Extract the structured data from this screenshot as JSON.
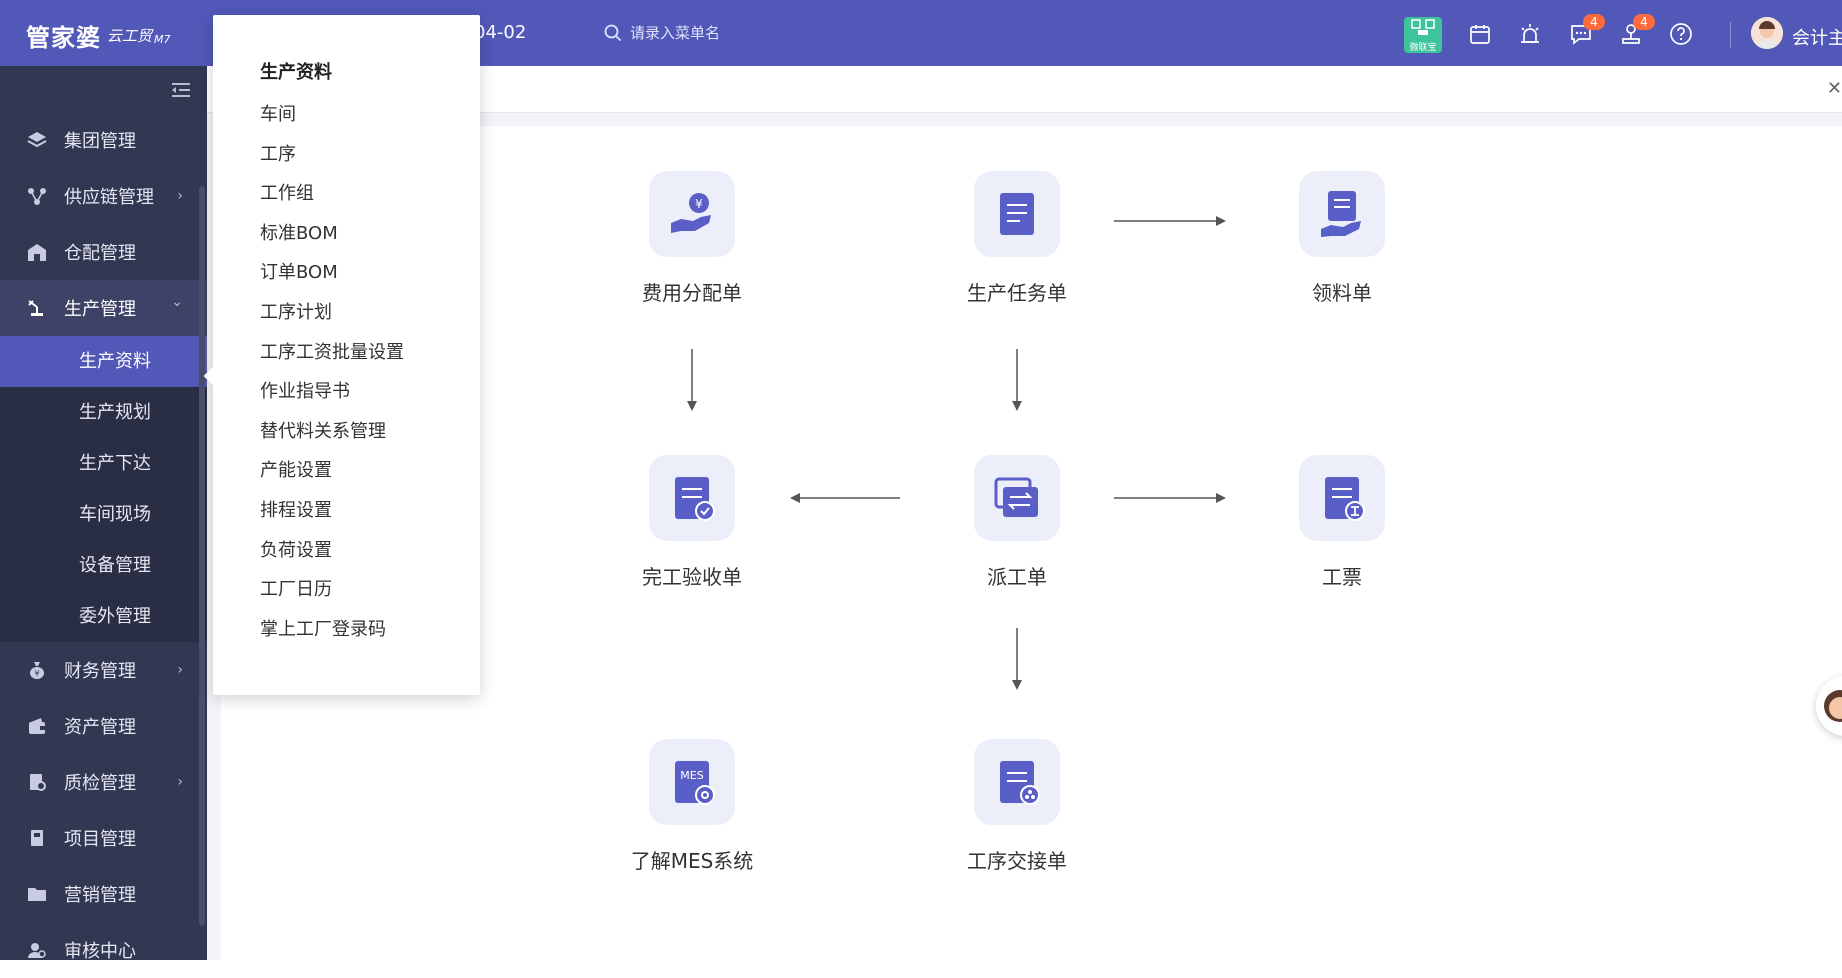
{
  "header": {
    "logo_text": "管家婆",
    "logo_sub": "云工贸",
    "logo_version": "M7",
    "date_text": "04-02",
    "search_placeholder": "请录入菜单名",
    "qr_label": "微联宝",
    "messages_badge": "4",
    "approvals_badge": "4",
    "user_name": "会计主",
    "accent_color": "#5258b8",
    "badge_color": "#ff6a3d"
  },
  "sidebar": {
    "items": [
      {
        "label": "集团管理",
        "icon": "layers-icon"
      },
      {
        "label": "供应链管理",
        "icon": "network-icon",
        "chevron": "›"
      },
      {
        "label": "仓配管理",
        "icon": "warehouse-icon"
      },
      {
        "label": "生产管理",
        "icon": "factory-icon",
        "chevron": "⌄"
      },
      {
        "label": "财务管理",
        "icon": "money-bag-icon",
        "chevron": "›"
      },
      {
        "label": "资产管理",
        "icon": "wallet-icon"
      },
      {
        "label": "质检管理",
        "icon": "inspection-icon",
        "chevron": "›"
      },
      {
        "label": "项目管理",
        "icon": "project-icon"
      },
      {
        "label": "营销管理",
        "icon": "folder-icon"
      },
      {
        "label": "审核中心",
        "icon": "audit-icon"
      }
    ],
    "production_sub": [
      {
        "label": "生产资料"
      },
      {
        "label": "生产规划"
      },
      {
        "label": "生产下达"
      },
      {
        "label": "车间现场"
      },
      {
        "label": "设备管理"
      },
      {
        "label": "委外管理"
      }
    ]
  },
  "flow": {
    "nodes": {
      "cost_allocation": "费用分配单",
      "production_task": "生产任务单",
      "material_requisition": "领料单",
      "completion_acceptance": "完工验收单",
      "dispatch": "派工单",
      "work_ticket": "工票",
      "mes_intro": "了解MES系统",
      "process_handover": "工序交接单"
    },
    "mes_icon_text": "MES"
  },
  "popover": {
    "title": "生产资料",
    "items": [
      "车间",
      "工序",
      "工作组",
      "标准BOM",
      "订单BOM",
      "工序计划",
      "工序工资批量设置",
      "作业指导书",
      "替代料关系管理",
      "产能设置",
      "排程设置",
      "负荷设置",
      "工厂日历",
      "掌上工厂登录码"
    ]
  }
}
